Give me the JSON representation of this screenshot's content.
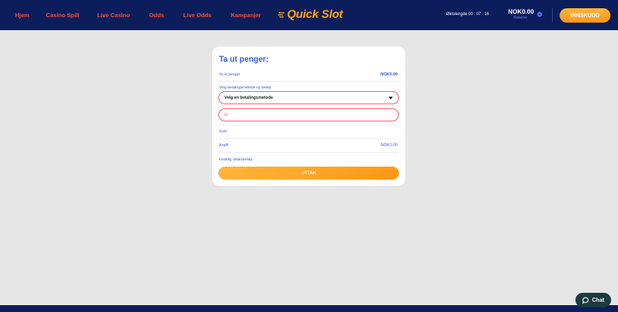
{
  "nav": {
    "items": [
      {
        "label": "Hjem"
      },
      {
        "label": "Casino Spill"
      },
      {
        "label": "Live Casino"
      },
      {
        "label": "Odds"
      },
      {
        "label": "Live Odds"
      },
      {
        "label": "Kampanjer"
      }
    ]
  },
  "brand": {
    "logo_text": "Quick Slot"
  },
  "header": {
    "session_text": "Øktslengde 00 : 07 : 16",
    "balance_amount": "NOK0.00",
    "balance_label": "Balanse",
    "deposit_label": "INNSKUDD"
  },
  "withdraw": {
    "title": "Ta ut penger:",
    "amount_label": "Ta ut penger",
    "amount_value": "NOK0.00",
    "method_label": "Velg betalingsmetode og beløp",
    "method_selected": "Velg en betalingsmetode",
    "amount_placeholder": "kr",
    "sum_label": "Sum:",
    "fee_label": "Avgift:",
    "fee_value": "NOK0.00",
    "final_label": "Endelig uttaksbeløp:",
    "submit_label": "UTTAK"
  },
  "chat": {
    "label": "Chat"
  },
  "colors": {
    "header_bg": "#0c1d5c",
    "nav_link": "#ff4d3a",
    "accent_orange": "#ff9716",
    "accent_blue": "#3b5bdb",
    "error_red": "#ff4d5e",
    "page_bg": "#e6e6e6"
  }
}
